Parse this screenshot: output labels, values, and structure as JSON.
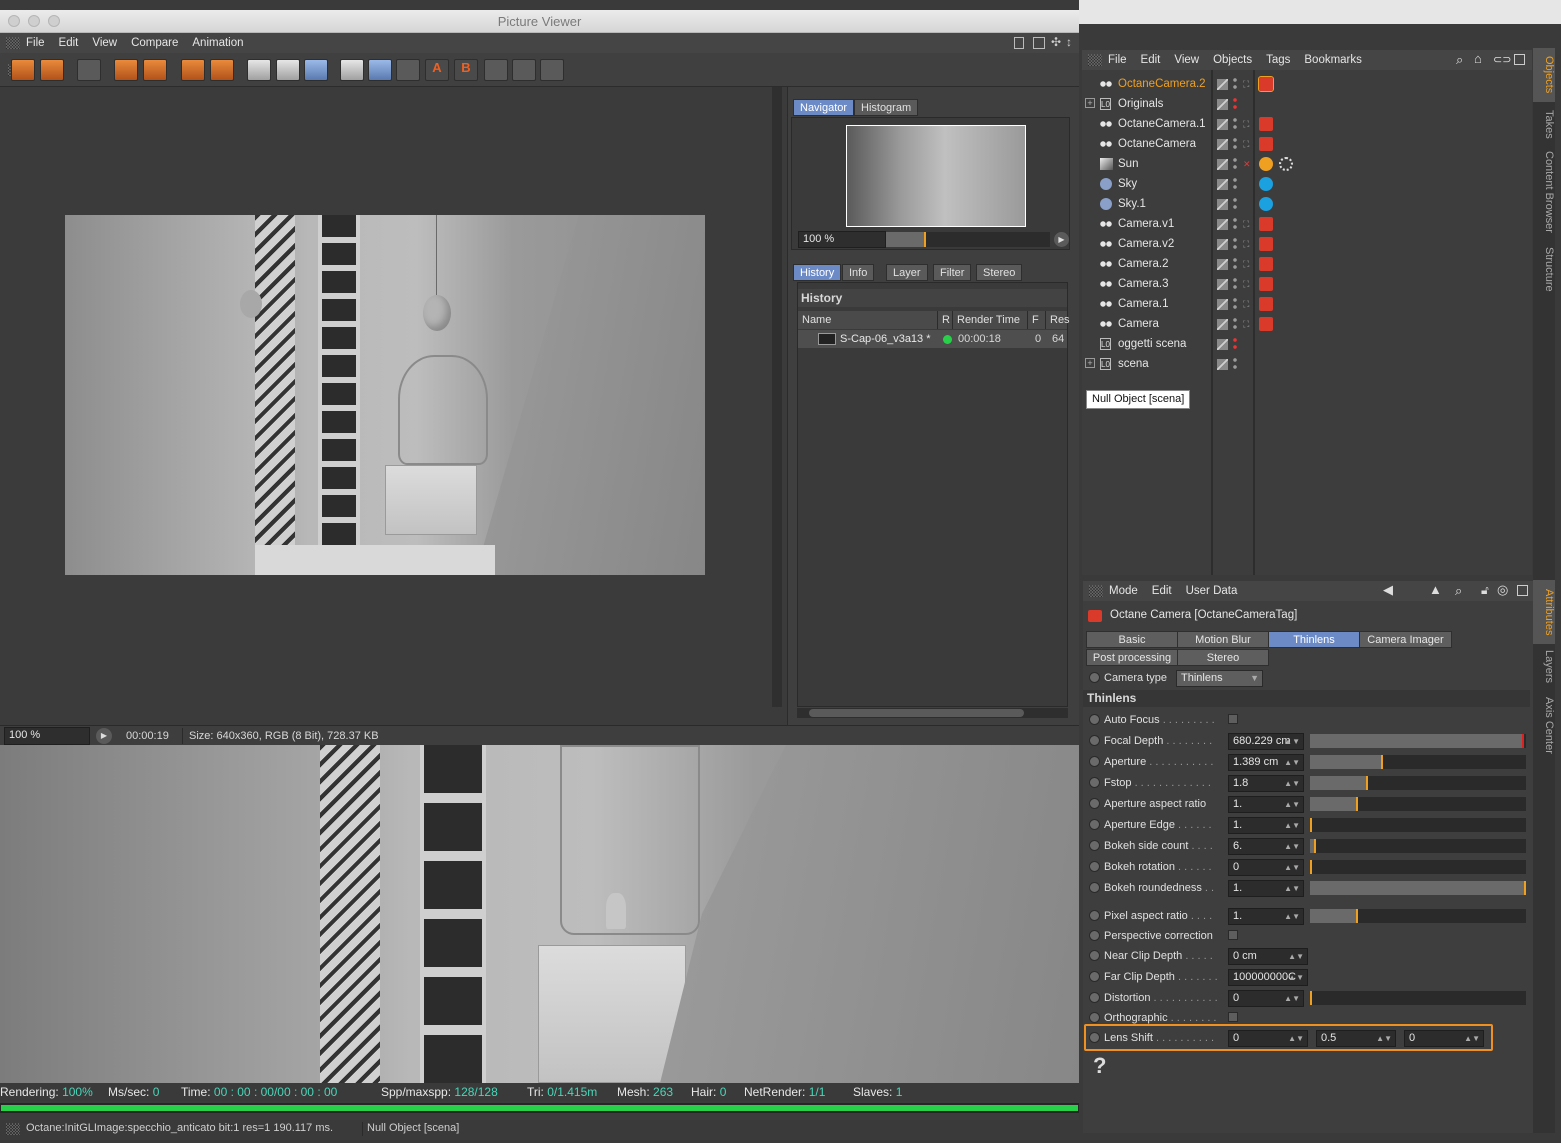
{
  "picture_viewer": {
    "title": "Picture Viewer",
    "menu": [
      "File",
      "Edit",
      "View",
      "Compare",
      "Animation"
    ],
    "navigator_tabs": [
      "Navigator",
      "Histogram"
    ],
    "nav_zoom": "100 %",
    "history_tabs": [
      "History",
      "Info",
      "Layer",
      "Filter",
      "Stereo"
    ],
    "history_title": "History",
    "history_columns": [
      "Name",
      "R",
      "Render Time",
      "F",
      "Res"
    ],
    "history_row": {
      "name": "S-Cap-06_v3a13 *",
      "time": "00:00:18",
      "f": "0",
      "res": "64"
    },
    "status": {
      "zoom": "100 %",
      "time": "00:00:19",
      "size": "Size: 640x360, RGB (8 Bit), 728.37 KB"
    },
    "stats": {
      "rendering_label": "Rendering:",
      "rendering": "100%",
      "mssec_label": "Ms/sec:",
      "mssec": "0",
      "time_label": "Time:",
      "time": "00 : 00 : 00/00 : 00 : 00",
      "spp_label": "Spp/maxspp:",
      "spp": "128/128",
      "tri_label": "Tri:",
      "tri": "0/1.415m",
      "mesh_label": "Mesh:",
      "mesh": "263",
      "hair_label": "Hair:",
      "hair": "0",
      "netrender_label": "NetRender:",
      "netrender": "1/1",
      "slaves_label": "Slaves:",
      "slaves": "1"
    },
    "progress": 1.0,
    "log_left": "Octane:InitGLImage:specchio_anticato  bit:1 res=1  190.117 ms.",
    "log_right": "Null Object [scena]"
  },
  "object_manager": {
    "menu": [
      "File",
      "Edit",
      "View",
      "Objects",
      "Tags",
      "Bookmarks"
    ],
    "objects": [
      {
        "name": "OctaneCamera.2",
        "tag": "camera",
        "active": true
      },
      {
        "name": "Originals",
        "tag": "none",
        "null": true
      },
      {
        "name": "OctaneCamera.1",
        "tag": "camera"
      },
      {
        "name": "OctaneCamera",
        "tag": "camera"
      },
      {
        "name": "Sun",
        "tag": "sun"
      },
      {
        "name": "Sky",
        "tag": "sky"
      },
      {
        "name": "Sky.1",
        "tag": "sky"
      },
      {
        "name": "Camera.v1",
        "tag": "camera"
      },
      {
        "name": "Camera.v2",
        "tag": "camera"
      },
      {
        "name": "Camera.2",
        "tag": "camera"
      },
      {
        "name": "Camera.3",
        "tag": "camera"
      },
      {
        "name": "Camera.1",
        "tag": "camera"
      },
      {
        "name": "Camera",
        "tag": "camera"
      },
      {
        "name": "oggetti scena",
        "tag": "none",
        "null": true
      },
      {
        "name": "scena",
        "tag": "none",
        "null": true
      }
    ],
    "tooltip": "Null Object [scena]"
  },
  "side_tabs_top": [
    "Objects",
    "Takes",
    "Content Browser",
    "Structure"
  ],
  "side_tabs_bottom": [
    "Attributes",
    "Layers",
    "Axis Center"
  ],
  "attributes": {
    "menu": [
      "Mode",
      "Edit",
      "User Data"
    ],
    "title": "Octane Camera [OctaneCameraTag]",
    "tabs_row1": [
      "Basic",
      "Motion Blur",
      "Thinlens",
      "Camera Imager"
    ],
    "tabs_row2": [
      "Post processing",
      "Stereo"
    ],
    "camera_type_label": "Camera type",
    "camera_type": "Thinlens",
    "section": "Thinlens",
    "fields": [
      {
        "label": "Auto Focus",
        "dots": " . . . . . . . . .",
        "type": "check"
      },
      {
        "label": "Focal Depth",
        "dots": " . . . . . . . .",
        "value": "680.229 cm",
        "fill": 0.99
      },
      {
        "label": "Aperture",
        "dots": " . . . . . . . . . . .",
        "value": "1.389 cm",
        "fill": 0.34
      },
      {
        "label": "Fstop",
        "dots": " . . . . . . . . . . . . .",
        "value": "1.8",
        "fill": 0.27
      },
      {
        "label": "Aperture aspect ratio",
        "dots": "",
        "value": "1.",
        "fill": 0.22
      },
      {
        "label": "Aperture Edge",
        "dots": " . . . . . .",
        "value": "1.",
        "fill": 0.0
      },
      {
        "label": "Bokeh side count",
        "dots": " . . . .",
        "value": "6.",
        "fill": 0.03
      },
      {
        "label": "Bokeh rotation",
        "dots": " . . . . . .",
        "value": "0",
        "fill": 0.0
      },
      {
        "label": "Bokeh roundedness",
        "dots": " . .",
        "value": "1.",
        "fill": 1.0
      },
      {
        "label": "Pixel aspect ratio",
        "dots": " . . . .",
        "value": "1.",
        "fill": 0.22
      },
      {
        "label": "Perspective correction",
        "dots": "",
        "type": "check"
      },
      {
        "label": "Near Clip Depth",
        "dots": " . . . . .",
        "value": "0 cm"
      },
      {
        "label": "Far Clip Depth",
        "dots": " . . . . . . .",
        "value": "100000000C"
      },
      {
        "label": "Distortion",
        "dots": " . . . . . . . . . . .",
        "value": "0",
        "fill": 0.0
      },
      {
        "label": "Orthographic",
        "dots": " . . . . . . . .",
        "type": "check"
      },
      {
        "label": "Lens Shift",
        "dots": " . . . . . . . . . .",
        "values": [
          "0",
          "0.5",
          "0"
        ]
      }
    ],
    "help": "?"
  },
  "colors": {
    "accent_blue": "#6b8ac6",
    "orange": "#f0a020",
    "active_object": "#f0a020",
    "green": "#28d04a",
    "teal": "#49d6b8"
  }
}
